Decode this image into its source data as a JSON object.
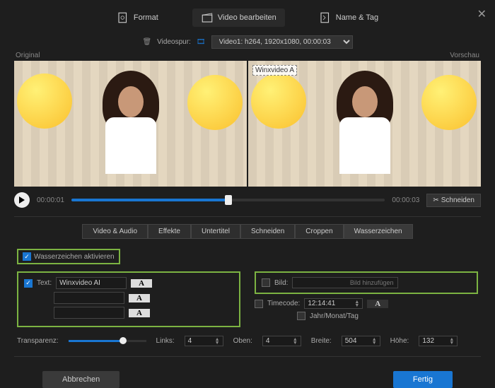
{
  "header": {
    "tabs": {
      "format": "Format",
      "edit": "Video bearbeiten",
      "nametag": "Name & Tag"
    }
  },
  "track": {
    "label": "Videospur:",
    "value": "Video1: h264, 1920x1080, 00:00:03"
  },
  "preview": {
    "original": "Original",
    "vorschau": "Vorschau",
    "watermark": "Winxvideo A"
  },
  "playbar": {
    "start": "00:00:01",
    "end": "00:00:03",
    "cut": "Schneiden"
  },
  "subtabs": {
    "va": "Video & Audio",
    "fx": "Effekte",
    "sub": "Untertitel",
    "cut": "Schneiden",
    "crop": "Croppen",
    "wm": "Wasserzeichen"
  },
  "wm": {
    "enable": "Wasserzeichen aktivieren",
    "text_label": "Text:",
    "text_value": "Winxvideo AI",
    "a": "A",
    "bild_label": "Bild:",
    "bild_placeholder": "Bild hinzufügen",
    "timecode_label": "Timecode:",
    "timecode_value": "12:14:41",
    "ymd": "Jahr/Monat/Tag",
    "transparency_label": "Transparenz:",
    "links_label": "Links:",
    "links_value": "4",
    "oben_label": "Oben:",
    "oben_value": "4",
    "breite_label": "Breite:",
    "breite_value": "504",
    "hoehe_label": "Höhe:",
    "hoehe_value": "132"
  },
  "footer": {
    "cancel": "Abbrechen",
    "done": "Fertig"
  }
}
